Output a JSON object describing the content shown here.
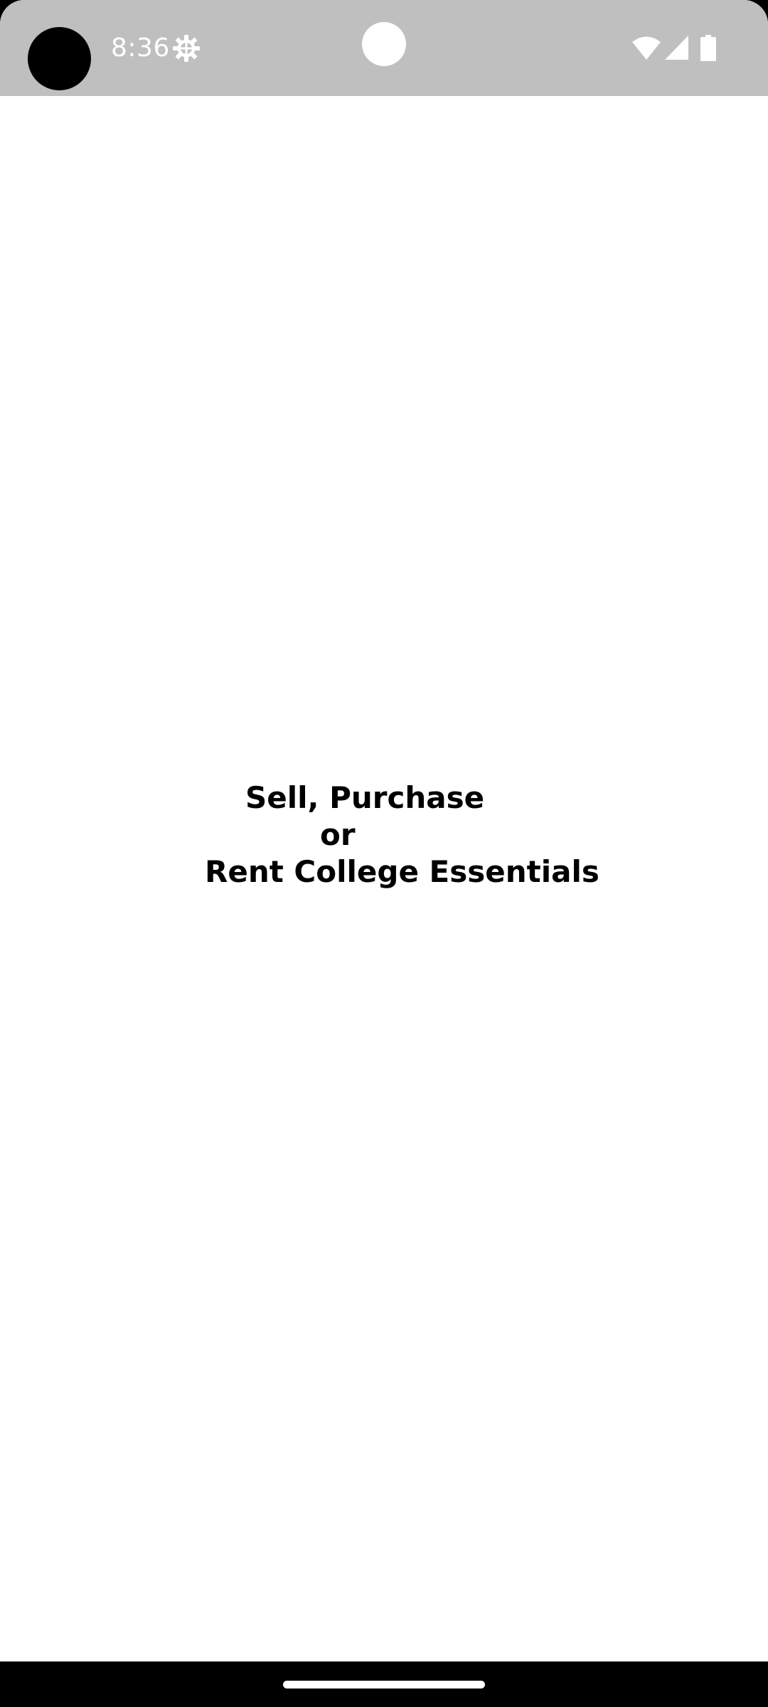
{
  "status_bar": {
    "time": "8:36",
    "icons": [
      "settings-icon",
      "wifi-icon",
      "cellular-signal-icon",
      "battery-icon"
    ],
    "background_color": "#bfbfbf",
    "icon_color": "#ffffff"
  },
  "splash": {
    "tagline_line1": "Sell, Purchase",
    "tagline_line2": "or",
    "tagline_line3": "Rent College Essentials"
  },
  "navigation": {
    "home_indicator": "home-indicator"
  }
}
